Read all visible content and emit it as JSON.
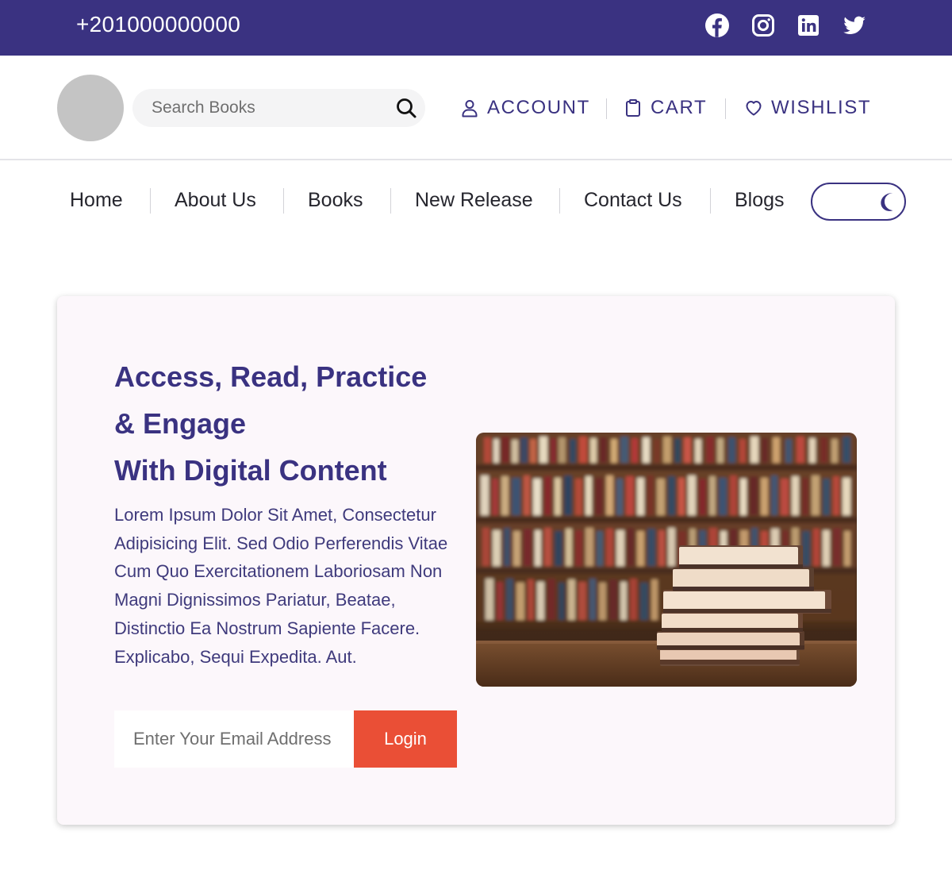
{
  "topbar": {
    "phone": "+201000000000",
    "social": [
      "facebook-icon",
      "instagram-icon",
      "linkedin-icon",
      "twitter-icon"
    ],
    "background": "#3a3281"
  },
  "header": {
    "search": {
      "placeholder": "Search Books",
      "value": ""
    },
    "links": {
      "account": "ACCOUNT",
      "cart": "CART",
      "wishlist": "WISHLIST"
    }
  },
  "nav": {
    "items": [
      "Home",
      "About Us",
      "Books",
      "New Release",
      "Contact Us",
      "Blogs"
    ],
    "theme_toggle_icon": "moon-icon"
  },
  "hero": {
    "title_lines": [
      "Access, Read, Practice",
      "& Engage",
      "With Digital Content"
    ],
    "body": "Lorem Ipsum Dolor Sit Amet, Consectetur Adipisicing Elit. Sed Odio Perferendis Vitae Cum Quo Exercitationem Laboriosam Non Magni Dignissimos Pariatur, Beatae, Distinctio Ea Nostrum Sapiente Facere. Explicabo, Sequi Expedita. Aut.",
    "email_placeholder": "Enter Your Email Address",
    "login_label": "Login",
    "image": "library-books-photo"
  },
  "colors": {
    "brand": "#3a3281",
    "accent": "#ea4f36",
    "card_bg": "#fcf7fb"
  }
}
